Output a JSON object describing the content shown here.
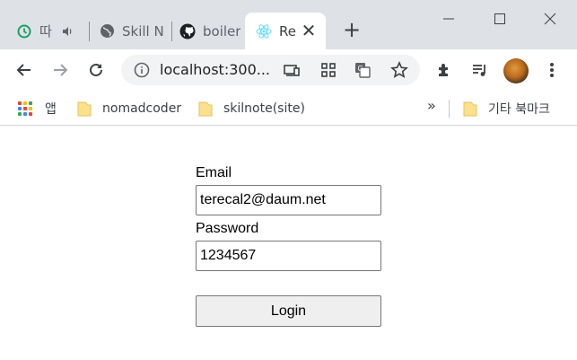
{
  "browser": {
    "tabs": [
      {
        "label": "따",
        "favicon": "clock-icon"
      },
      {
        "label": "Skill N",
        "favicon": "globe-icon"
      },
      {
        "label": "boiler",
        "favicon": "github-icon"
      },
      {
        "label": "Re",
        "favicon": "react-icon",
        "active": true
      }
    ],
    "new_tab_symbol": "+",
    "address": "localhost:300...",
    "colors": {
      "titlebar": "#dee1e6",
      "toolbar": "#ffffff",
      "omnibox": "#f1f3f4"
    }
  },
  "bookmarks": {
    "apps_label": "앱",
    "items": [
      {
        "label": "nomadcoder",
        "icon": "folder-icon"
      },
      {
        "label": "skilnote(site)",
        "icon": "folder-icon"
      }
    ],
    "overflow_symbol": "»",
    "other_label": "기타 북마크"
  },
  "form": {
    "email_label": "Email",
    "email_value": "terecal2@daum.net",
    "password_label": "Password",
    "password_value": "1234567",
    "login_label": "Login"
  }
}
